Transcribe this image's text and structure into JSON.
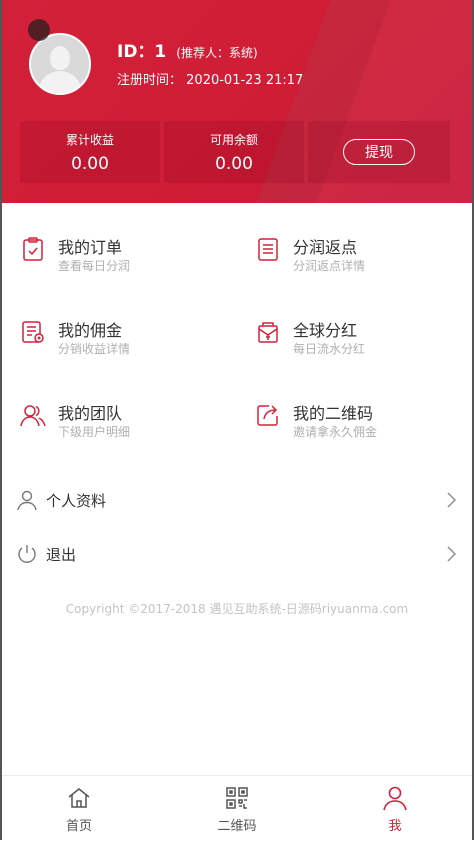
{
  "header": {
    "uid_label": "ID：1",
    "referrer": "(推荐人：系统)",
    "reg_label": "注册时间：",
    "reg_time": "2020-01-23 21:17",
    "stats": [
      {
        "label": "累计收益",
        "value": "0.00"
      },
      {
        "label": "可用余额",
        "value": "0.00"
      }
    ],
    "withdraw_label": "提现"
  },
  "grid": [
    {
      "title": "我的订单",
      "sub": "查看每日分润",
      "icon": "clipboard-check-icon"
    },
    {
      "title": "分润返点",
      "sub": "分润返点详情",
      "icon": "list-document-icon"
    },
    {
      "title": "我的佣金",
      "sub": "分销收益详情",
      "icon": "commission-document-icon"
    },
    {
      "title": "全球分红",
      "sub": "每日流水分红",
      "icon": "red-envelope-icon"
    },
    {
      "title": "我的团队",
      "sub": "下级用户明细",
      "icon": "team-users-icon"
    },
    {
      "title": "我的二维码",
      "sub": "邀请拿永久佣金",
      "icon": "share-icon"
    }
  ],
  "rows": [
    {
      "label": "个人资料",
      "icon": "user-icon"
    },
    {
      "label": "退出",
      "icon": "power-icon"
    }
  ],
  "copyright": "Copyright ©2017-2018 遇见互助系统-日源码riyuanma.com",
  "tabs": [
    {
      "label": "首页",
      "icon": "home-icon"
    },
    {
      "label": "二维码",
      "icon": "qrcode-icon"
    },
    {
      "label": "我",
      "icon": "user-icon"
    }
  ],
  "colors": {
    "accent": "#d4213a",
    "subtext": "#b0b0b0"
  }
}
